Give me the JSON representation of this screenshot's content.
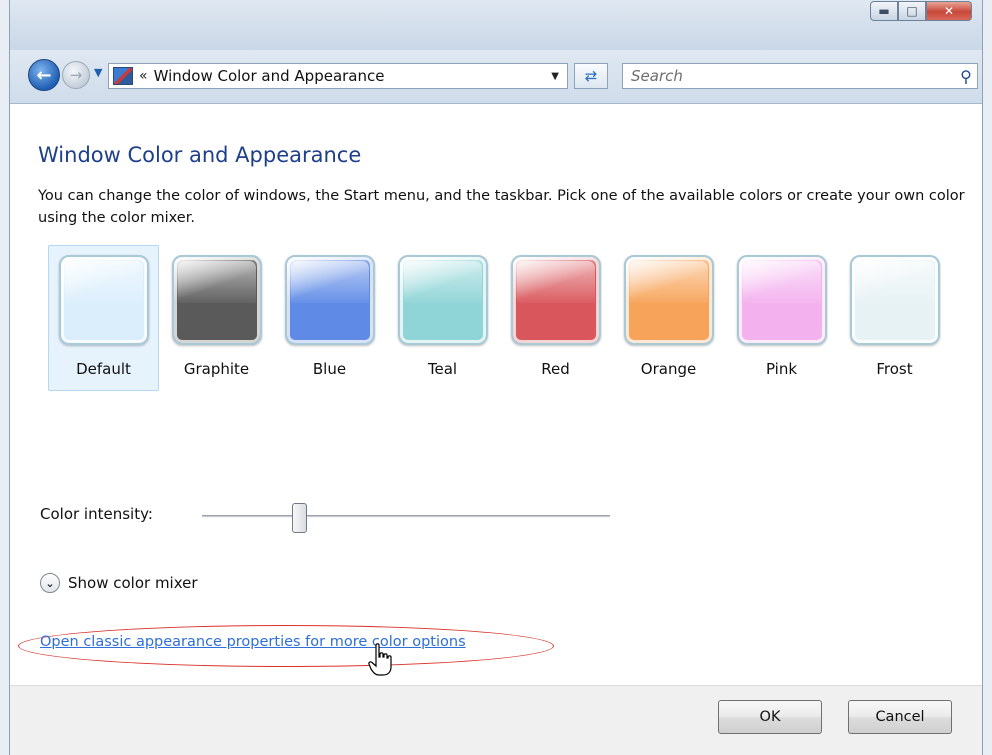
{
  "window": {
    "minimize_icon": "minimize-icon",
    "maximize_icon": "maximize-icon",
    "close_icon": "close-icon"
  },
  "navbar": {
    "address_chevron": "«",
    "address_text": "Window Color and Appearance",
    "search_placeholder": "Search"
  },
  "main": {
    "title": "Window Color and Appearance",
    "description": "You can change the color of windows, the Start menu, and the taskbar. Pick one of the available colors or create your own color using the color mixer.",
    "swatches": [
      {
        "label": "Default",
        "color": "#dbeefc",
        "selected": true
      },
      {
        "label": "Graphite",
        "color": "#5a5a5a",
        "selected": false
      },
      {
        "label": "Blue",
        "color": "#5f8be6",
        "selected": false
      },
      {
        "label": "Teal",
        "color": "#8fd4d6",
        "selected": false
      },
      {
        "label": "Red",
        "color": "#d9575c",
        "selected": false
      },
      {
        "label": "Orange",
        "color": "#f7a45a",
        "selected": false
      },
      {
        "label": "Pink",
        "color": "#f3b2ee",
        "selected": false
      },
      {
        "label": "Frost",
        "color": "#e7f2f4",
        "selected": false
      }
    ],
    "intensity_label": "Color intensity:",
    "intensity_value": 0.24,
    "mixer_label": "Show color mixer",
    "classic_link": "Open classic appearance properties for more color options"
  },
  "footer": {
    "ok_label": "OK",
    "cancel_label": "Cancel"
  },
  "colors": {
    "title_blue": "#1e3f8a",
    "link_blue": "#2f6fd8",
    "highlight_red": "#d8322a"
  }
}
